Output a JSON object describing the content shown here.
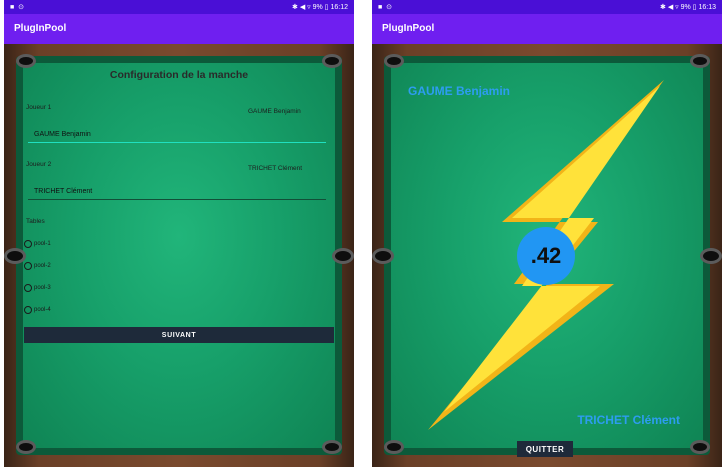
{
  "left_screen": {
    "status_left": "■ ⊙",
    "status_right": "✱ ◀ ▿ 9% ▯ 16:12",
    "app_title": "PlugInPool",
    "config_title": "Configuration de la manche",
    "player1_label": "Joueur 1",
    "player1_display": "GAUME Benjamin",
    "player1_input": "GAUME Benjamin",
    "player2_label": "Joueur 2",
    "player2_display": "TRICHET Clément",
    "player2_input": "TRICHET Clément",
    "tables_label": "Tables",
    "tables": [
      "pool-1",
      "pool-2",
      "pool-3",
      "pool-4"
    ],
    "next_button": "SUIVANT"
  },
  "right_screen": {
    "status_left": "■ ⊙",
    "status_right": "✱ ◀ ▿ 9% ▯ 16:13",
    "app_title": "PlugInPool",
    "player_top": "GAUME Benjamin",
    "score": ".42",
    "player_bottom": "TRICHET Clément",
    "quit_button": "QUITTER"
  },
  "colors": {
    "status_bar": "#4a0fd6",
    "app_bar": "#6f1ff0",
    "felt": "#17a06a",
    "rail": "#6b4027",
    "player_name": "#2d9df0",
    "score_circle": "#2196f3",
    "button": "#1e2a3a",
    "input_underline_active": "#20e0c0",
    "bolt_light": "#ffe23a",
    "bolt_dark": "#f2b418"
  },
  "icons": {
    "bolt": "lightning-bolt-icon",
    "radio": "radio-button-icon",
    "pocket": "pool-pocket"
  }
}
